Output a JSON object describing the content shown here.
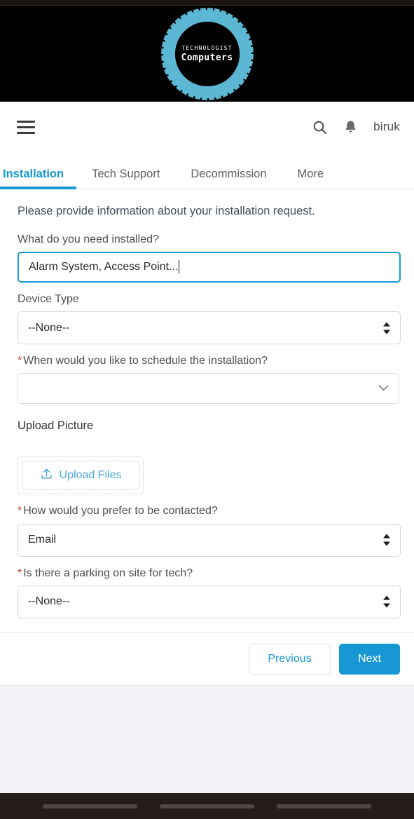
{
  "logo": {
    "top_text": "TECHNOLOGIST",
    "bottom_text": "Computers",
    "ring_color": "#5bb7d3"
  },
  "header": {
    "menu_icon": "hamburger-menu-icon",
    "search_icon": "search-icon",
    "notification_icon": "bell-icon",
    "username": "biruk"
  },
  "tabs": [
    {
      "label": "Installation",
      "active": true
    },
    {
      "label": "Tech Support",
      "active": false
    },
    {
      "label": "Decommission",
      "active": false
    },
    {
      "label": "More",
      "active": false
    }
  ],
  "form": {
    "intro": "Please provide information about your installation request.",
    "fields": {
      "need_installed": {
        "label": "What do you need installed?",
        "value": "Alarm System, Access Point...",
        "required": false,
        "focused": true
      },
      "device_type": {
        "label": "Device Type",
        "value": "--None--",
        "required": false
      },
      "schedule": {
        "label": "When would you like to schedule the installation?",
        "value": "",
        "required": true
      },
      "upload_picture": {
        "label": "Upload Picture",
        "button_label": "Upload Files",
        "icon": "upload-icon"
      },
      "contact_preference": {
        "label": "How would you prefer to be contacted?",
        "value": "Email",
        "required": true
      },
      "parking": {
        "label": "Is there a parking on site for tech?",
        "value": "--None--",
        "required": true
      }
    },
    "required_marker": "*"
  },
  "actions": {
    "previous_label": "Previous",
    "next_label": "Next"
  },
  "colors": {
    "accent": "#1798d5",
    "required": "#c23934",
    "page_bg": "#f3f4f7"
  }
}
